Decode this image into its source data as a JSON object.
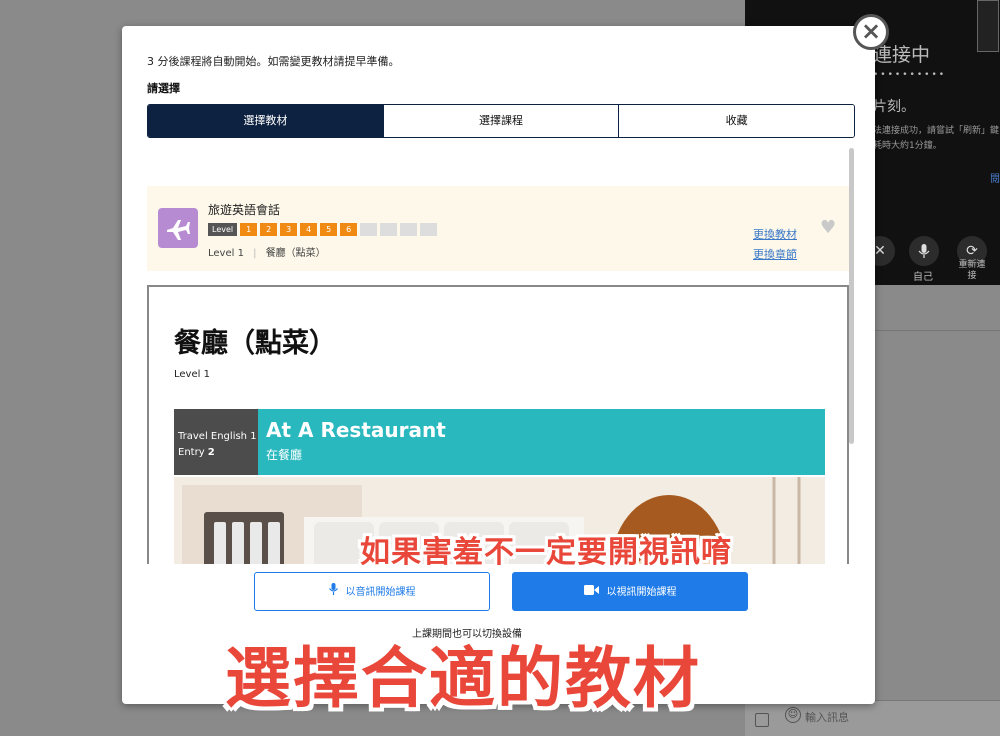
{
  "background": {
    "video_panel": {
      "title": "連接中",
      "dots": "••••••••••",
      "wait_text": "片刻。",
      "message": "法連接成功，請嘗試「刷新」鍵耗時大約1分鐘。",
      "link": "閱",
      "controls": [
        {
          "icon": "camera-off-icon",
          "label": ""
        },
        {
          "icon": "microphone-icon",
          "label": "自己"
        },
        {
          "icon": "refresh-icon",
          "label": "重新連接"
        }
      ]
    },
    "chat": {
      "placeholder": "輸入訊息"
    }
  },
  "modal": {
    "close_label": "×",
    "notice": "3 分後課程將自動開始。如需變更教材請提早準備。",
    "choose_label": "請選擇",
    "tabs": [
      {
        "label": "選擇教材",
        "active": true
      },
      {
        "label": "選擇課程",
        "active": false
      },
      {
        "label": "收藏",
        "active": false
      }
    ],
    "material_card": {
      "icon": "airplane-icon",
      "title": "旅遊英語會話",
      "level_tag": "Level",
      "levels": [
        "1",
        "2",
        "3",
        "4",
        "5",
        "6",
        "",
        "",
        "",
        ""
      ],
      "levels_active": 6,
      "subtitle_level": "Level 1",
      "subtitle_sep": "|",
      "subtitle_chapter": "餐廳（點菜）",
      "change_material": "更換教材",
      "change_chapter": "更換章節",
      "favorite_icon": "heart-icon"
    },
    "document": {
      "title": "餐廳（點菜）",
      "level": "Level 1",
      "banner": {
        "series": "Travel English 1",
        "entry_label": "Entry",
        "entry_number": "2",
        "title_en": "At A Restaurant",
        "title_zh": "在餐廳"
      }
    },
    "buttons": {
      "audio": "以音訊開始課程",
      "video": "以視訊開始課程"
    },
    "note": "上課期間也可以切換設備"
  },
  "captions": {
    "small": "如果害羞不一定要開視訊唷",
    "big": "選擇合適的教材"
  },
  "colors": {
    "tab_active": "#0d2240",
    "primary": "#1e7be8",
    "level_on": "#f08a12",
    "banner_teal": "#29b8be",
    "caption": "#e8473a",
    "card_bg": "#fdf8ea"
  }
}
